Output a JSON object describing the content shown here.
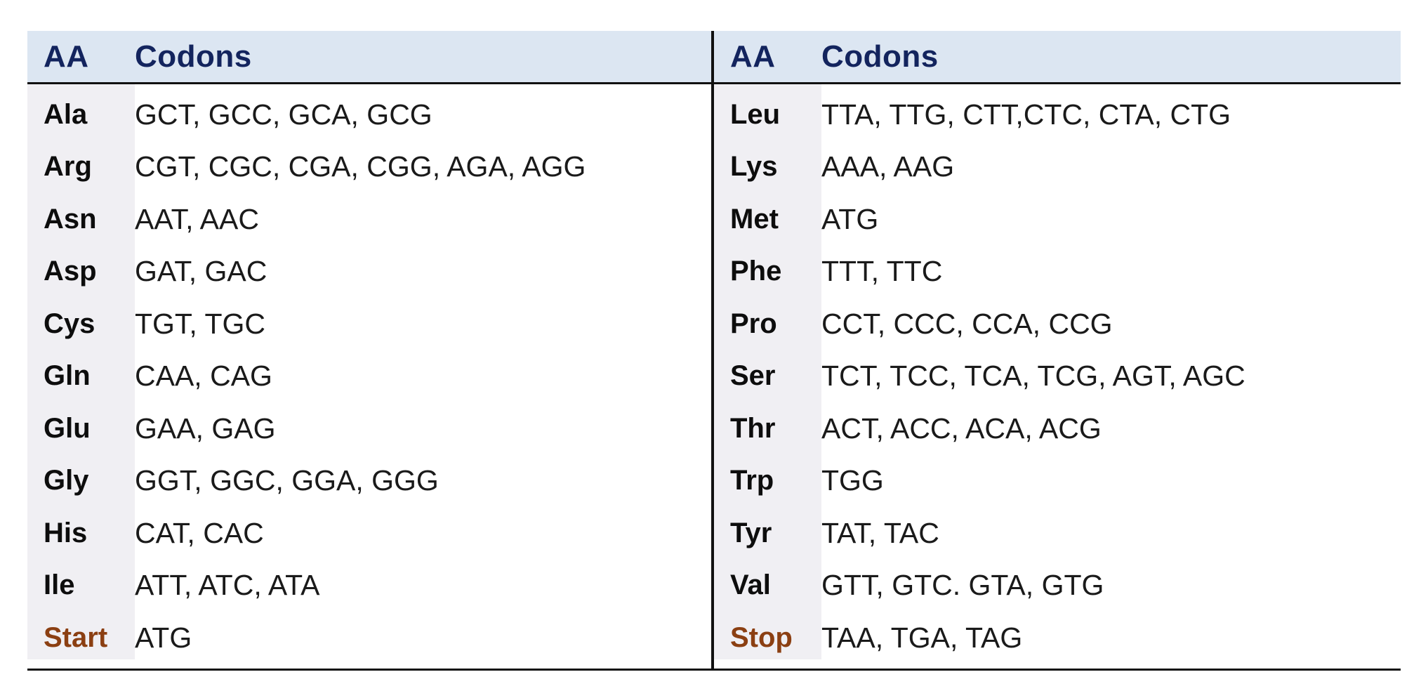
{
  "table": {
    "headers": {
      "aa": "AA",
      "codons": "Codons"
    },
    "left": [
      {
        "aa": "Ala",
        "codons": "GCT, GCC, GCA, GCG",
        "signal": false
      },
      {
        "aa": "Arg",
        "codons": "CGT, CGC, CGA, CGG, AGA, AGG",
        "signal": false
      },
      {
        "aa": "Asn",
        "codons": "AAT, AAC",
        "signal": false
      },
      {
        "aa": "Asp",
        "codons": "GAT, GAC",
        "signal": false
      },
      {
        "aa": "Cys",
        "codons": "TGT, TGC",
        "signal": false
      },
      {
        "aa": "Gln",
        "codons": "CAA, CAG",
        "signal": false
      },
      {
        "aa": "Glu",
        "codons": "GAA, GAG",
        "signal": false
      },
      {
        "aa": "Gly",
        "codons": "GGT, GGC, GGA, GGG",
        "signal": false
      },
      {
        "aa": "His",
        "codons": "CAT, CAC",
        "signal": false
      },
      {
        "aa": "Ile",
        "codons": "ATT, ATC, ATA",
        "signal": false
      },
      {
        "aa": "Start",
        "codons": "ATG",
        "signal": true
      }
    ],
    "right": [
      {
        "aa": "Leu",
        "codons": "TTA, TTG, CTT,CTC, CTA, CTG",
        "signal": false
      },
      {
        "aa": "Lys",
        "codons": "AAA, AAG",
        "signal": false
      },
      {
        "aa": "Met",
        "codons": "ATG",
        "signal": false
      },
      {
        "aa": "Phe",
        "codons": "TTT, TTC",
        "signal": false
      },
      {
        "aa": "Pro",
        "codons": "CCT, CCC, CCA, CCG",
        "signal": false
      },
      {
        "aa": "Ser",
        "codons": "TCT, TCC, TCA, TCG, AGT, AGC",
        "signal": false
      },
      {
        "aa": "Thr",
        "codons": "ACT, ACC, ACA, ACG",
        "signal": false
      },
      {
        "aa": "Trp",
        "codons": "TGG",
        "signal": false
      },
      {
        "aa": "Tyr",
        "codons": "TAT, TAC",
        "signal": false
      },
      {
        "aa": "Val",
        "codons": "GTT, GTC. GTA, GTG",
        "signal": false
      },
      {
        "aa": "Stop",
        "codons": "TAA, TGA, TAG",
        "signal": true
      }
    ]
  },
  "colors": {
    "header_background": "#dce6f2",
    "header_text": "#13245e",
    "aa_column_background": "#f0eff3",
    "signal_text": "#8b3f12",
    "rule": "#111111"
  }
}
